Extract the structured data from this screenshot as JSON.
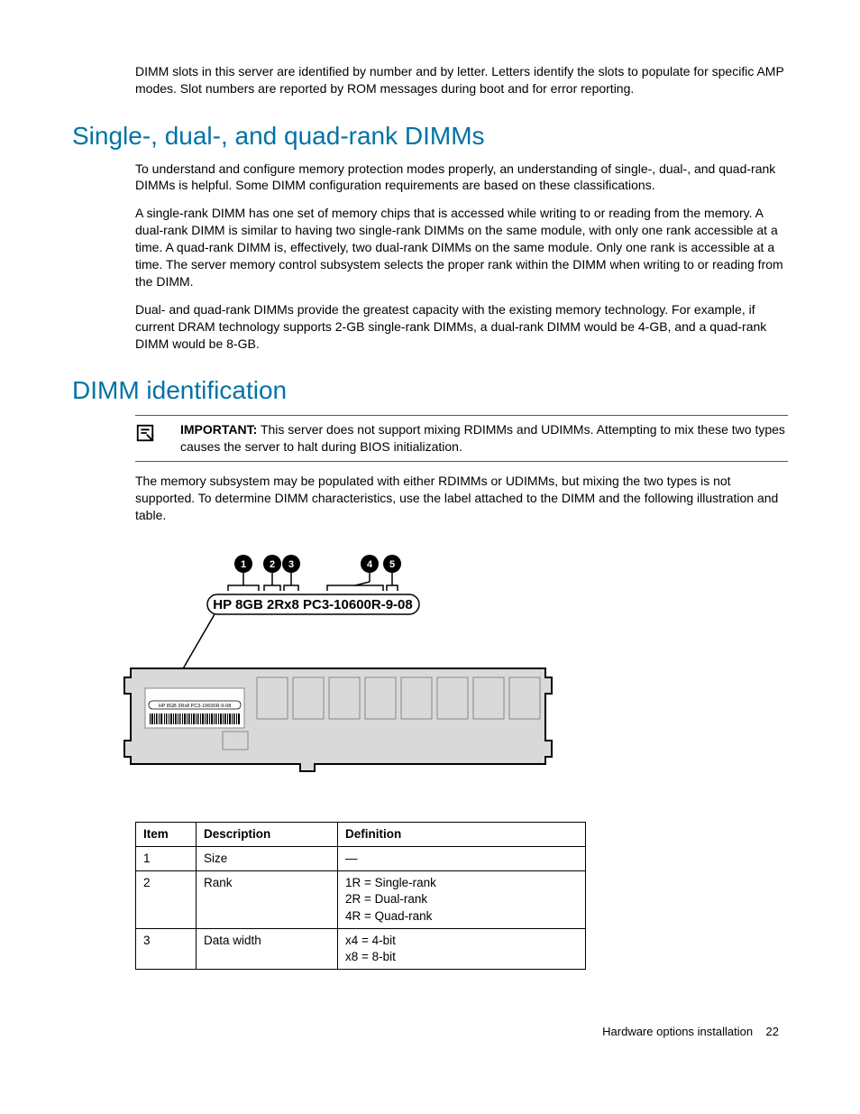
{
  "intro_para": "DIMM slots in this server are identified by number and by letter. Letters identify the slots to populate for specific AMP modes. Slot numbers are reported by ROM messages during boot and for error reporting.",
  "h1_ranks": "Single-, dual-, and quad-rank DIMMs",
  "para_ranks_1": "To understand and configure memory protection modes properly, an understanding of single-, dual-, and quad-rank DIMMs is helpful. Some DIMM configuration requirements are based on these classifications.",
  "para_ranks_2": "A single-rank DIMM has one set of memory chips that is accessed while writing to or reading from the memory. A dual-rank DIMM is similar to having two single-rank DIMMs on the same module, with only one rank accessible at a time. A quad-rank DIMM is, effectively, two dual-rank DIMMs on the same module. Only one rank is accessible at a time. The server memory control subsystem selects the proper rank within the DIMM when writing to or reading from the DIMM.",
  "para_ranks_3": "Dual- and quad-rank DIMMs provide the greatest capacity with the existing memory technology. For example, if current DRAM technology supports 2-GB single-rank DIMMs, a dual-rank DIMM would be 4-GB, and a quad-rank DIMM would be 8-GB.",
  "h1_ident": "DIMM identification",
  "important_label": "IMPORTANT:",
  "important_text": "This server does not support mixing RDIMMs and UDIMMs. Attempting to mix these two types causes the server to halt during BIOS initialization.",
  "para_ident_1": "The memory subsystem may be populated with either RDIMMs or UDIMMs, but mixing the two types is not supported. To determine DIMM characteristics, use the label attached to the DIMM and the following illustration and table.",
  "label_text": "HP 8GB 2Rx8 PC3-10600R-9-08",
  "callout_1": "1",
  "callout_2": "2",
  "callout_3": "3",
  "callout_4": "4",
  "callout_5": "5",
  "table": {
    "headers": {
      "c1": "Item",
      "c2": "Description",
      "c3": "Definition"
    },
    "rows": [
      {
        "item": "1",
        "desc": "Size",
        "def": "—"
      },
      {
        "item": "2",
        "desc": "Rank",
        "def": "1R = Single-rank\n2R = Dual-rank\n4R = Quad-rank"
      },
      {
        "item": "3",
        "desc": "Data width",
        "def": "x4 = 4-bit\nx8 = 8-bit"
      }
    ]
  },
  "footer_text": "Hardware options installation",
  "footer_page": "22"
}
